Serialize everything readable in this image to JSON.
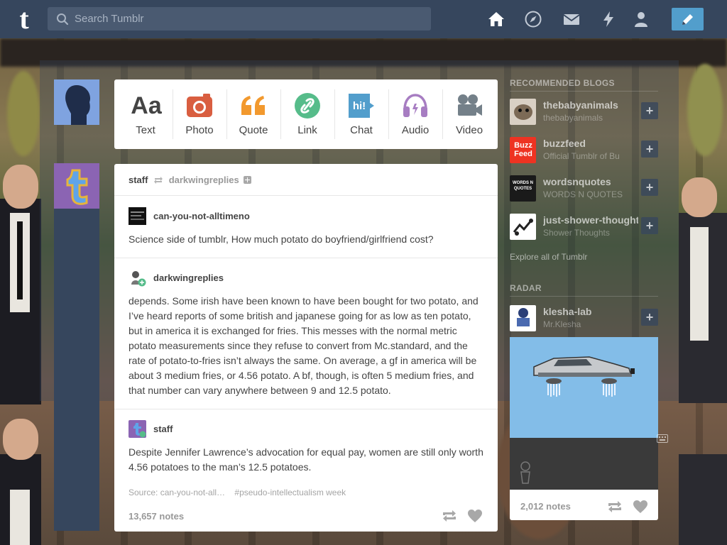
{
  "topbar": {
    "logo": "t",
    "search_placeholder": "Search Tumblr"
  },
  "composer": {
    "types": [
      {
        "label": "Text",
        "icon": "text-icon",
        "color": "#444444"
      },
      {
        "label": "Photo",
        "icon": "camera-icon",
        "color": "#d95e40"
      },
      {
        "label": "Quote",
        "icon": "quote-icon",
        "color": "#f2992e"
      },
      {
        "label": "Link",
        "icon": "link-icon",
        "color": "#56bc8a"
      },
      {
        "label": "Chat",
        "icon": "chat-icon",
        "color": "#529ecc"
      },
      {
        "label": "Audio",
        "icon": "headphones-icon",
        "color": "#a77dc2"
      },
      {
        "label": "Video",
        "icon": "video-camera-icon",
        "color": "#748089"
      }
    ],
    "text_glyph": "Aa",
    "chat_glyph": "hi!"
  },
  "post": {
    "reblogger": "staff",
    "reblogged_from": "darkwingreplies",
    "trail": [
      {
        "name": "can-you-not-alltimeno",
        "text": "Science side of tumblr, How much potato do boyfriend/girlfriend cost?"
      },
      {
        "name": "darkwingreplies",
        "text": "depends. Some irish have been known to have been bought for two potato, and I’ve heard reports of some british and japanese going for as low as ten potato, but in america it is exchanged for fries. This messes with the normal metric potato measurements since they refuse to convert from Mc.standard, and the rate of potato-to-fries isn’t always the same. On average, a gf in america will be about 3 medium fries, or 4.56 potato. A bf, though, is often 5 medium fries, and that number can vary anywhere between 9 and 12.5 potato."
      },
      {
        "name": "staff",
        "text": "Despite Jennifer Lawrence’s advocation for equal pay, women are still only worth 4.56 potatoes to the man’s 12.5 potatoes."
      }
    ],
    "source": "Source: can-you-not-all…",
    "tag": "#pseudo-intellectualism week",
    "notes": "13,657 notes"
  },
  "sidebar": {
    "recommended_header": "RECOMMENDED BLOGS",
    "blogs": [
      {
        "name": "thebabyanimals",
        "subtitle": "thebabyanimals"
      },
      {
        "name": "buzzfeed",
        "subtitle": "Official Tumblr of Bu"
      },
      {
        "name": "wordsnquotes",
        "subtitle": "WORDS N QUOTES"
      },
      {
        "name": "just-shower-thoughts",
        "subtitle": "Shower Thoughts"
      }
    ],
    "buzzfeed_logo": "Buzz Feed",
    "wordsnquotes_logo": "WORDS N QUOTES",
    "explore": "Explore all of Tumblr",
    "radar_header": "RADAR",
    "radar": {
      "name": "klesha-lab",
      "subtitle": "Mr.Klesha",
      "notes": "2,012 notes"
    }
  }
}
